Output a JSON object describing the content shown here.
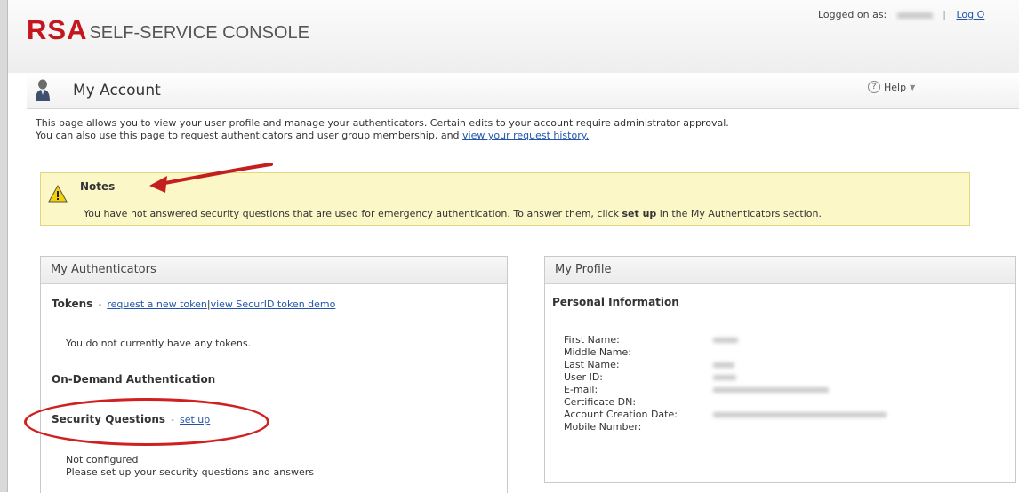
{
  "header": {
    "brand": "RSA",
    "product": "SELF-SERVICE CONSOLE",
    "logged_on_label": "Logged on as:",
    "logout_label": "Log O"
  },
  "page": {
    "title": "My Account",
    "help_label": "Help",
    "intro_line1": "This page allows you to view your user profile and manage your authenticators. Certain edits to your account require administrator approval.",
    "intro_line2": "You can also use this page to request authenticators and user group membership, and ",
    "request_history_link": "view your request history."
  },
  "notes": {
    "title": "Notes",
    "text_before": "You have not answered security questions that are used for emergency authentication. To answer them, click ",
    "text_bold": "set up",
    "text_after": " in the My Authenticators section."
  },
  "authenticators": {
    "heading": "My Authenticators",
    "tokens_label": "Tokens",
    "request_token_link": "request a new token",
    "token_demo_link": "view SecurID token demo",
    "no_tokens_text": "You do not currently have any tokens.",
    "on_demand_label": "On-Demand Authentication",
    "security_questions_label": "Security Questions",
    "setup_link": "set up",
    "not_configured": "Not configured",
    "setup_prompt": "Please set up your security questions and answers"
  },
  "profile": {
    "heading": "My Profile",
    "section_title": "Personal Information",
    "fields": [
      "First Name:",
      "Middle Name:",
      "Last Name:",
      "User ID:",
      "E-mail:",
      "Certificate DN:",
      "Account Creation Date:",
      "Mobile Number:"
    ]
  },
  "colors": {
    "brand_red": "#c4161c",
    "link_blue": "#2255aa",
    "notes_bg": "#fbf7c7",
    "annotation_red": "#d02020"
  }
}
